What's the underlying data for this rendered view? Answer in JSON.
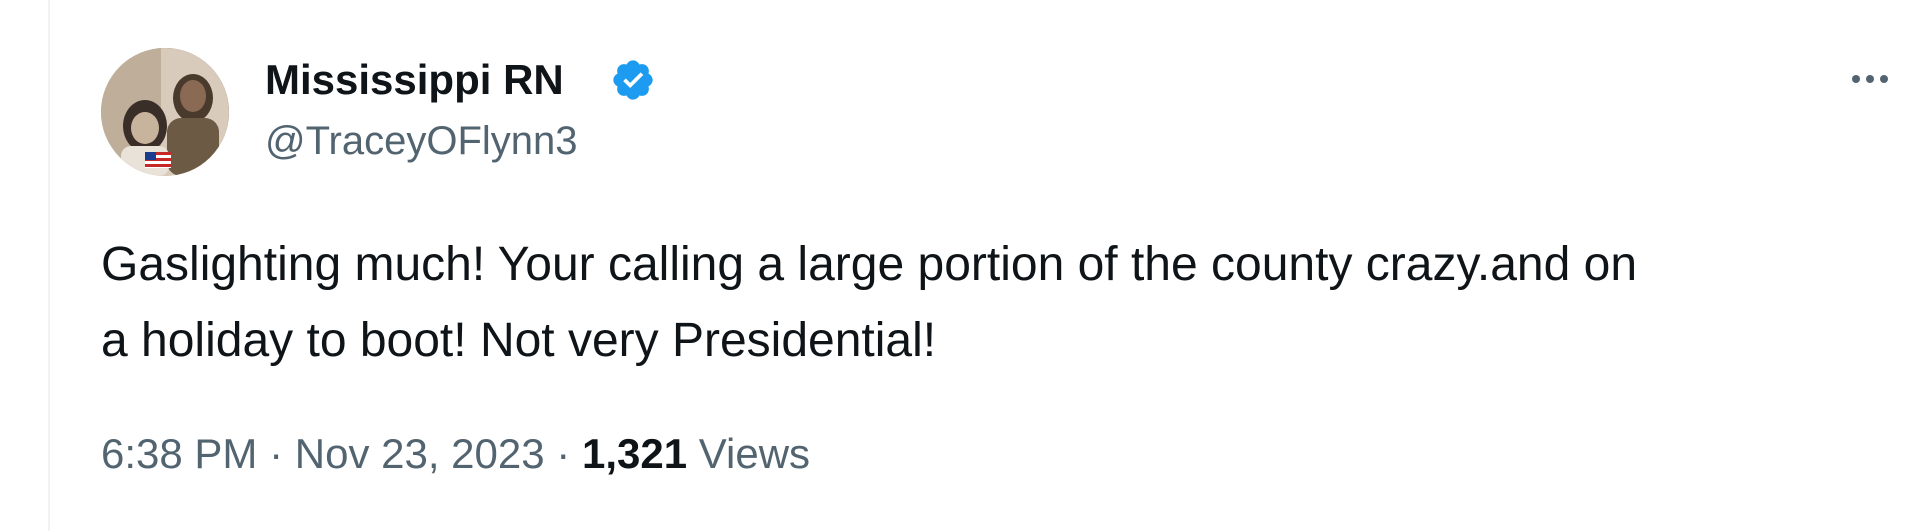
{
  "tweet": {
    "author": {
      "display_name": "Mississippi RN",
      "handle": "@TraceyOFlynn3",
      "verified_icon": "verified-badge-icon",
      "verified_color": "#1d9bf0",
      "avatar_icon": "profile-photo"
    },
    "text_line1": "Gaslighting much! Your calling a large portion of the county crazy.and on",
    "text_line2": "a holiday to boot! Not very Presidential!",
    "time": "6:38 PM",
    "separator": "·",
    "date": "Nov 23, 2023",
    "views_count": "1,321",
    "views_label": "Views",
    "more_icon": "more-options-icon"
  },
  "colors": {
    "text_primary": "#0f1419",
    "text_secondary": "#536471",
    "border": "#eff3f4"
  }
}
